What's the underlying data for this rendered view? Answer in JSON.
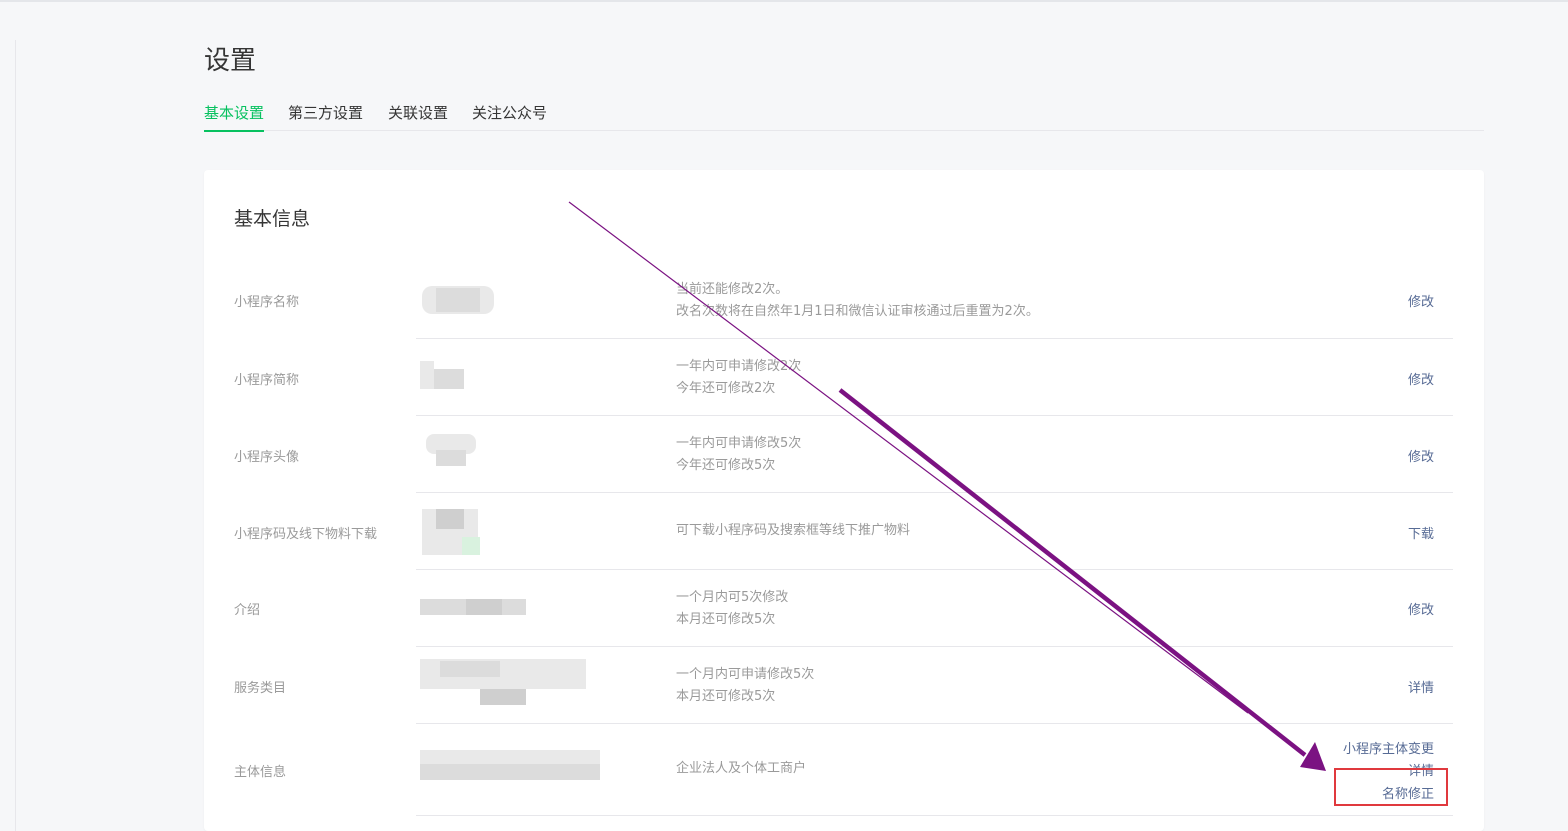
{
  "page": {
    "title": "设置"
  },
  "tabs": [
    {
      "label": "基本设置",
      "active": true
    },
    {
      "label": "第三方设置",
      "active": false
    },
    {
      "label": "关联设置",
      "active": false
    },
    {
      "label": "关注公众号",
      "active": false
    }
  ],
  "card": {
    "title": "基本信息"
  },
  "rows": [
    {
      "label": "小程序名称",
      "desc1": "当前还能修改2次。",
      "desc2": "改名次数将在自然年1月1日和微信认证审核通过后重置为2次。",
      "action": "修改"
    },
    {
      "label": "小程序简称",
      "desc1": "一年内可申请修改2次",
      "desc2": "今年还可修改2次",
      "action": "修改"
    },
    {
      "label": "小程序头像",
      "desc1": "一年内可申请修改5次",
      "desc2": "今年还可修改5次",
      "action": "修改"
    },
    {
      "label": "小程序码及线下物料下载",
      "desc1": "可下载小程序码及搜索框等线下推广物料",
      "desc2": "",
      "action": "下载"
    },
    {
      "label": "介绍",
      "desc1": "一个月内可5次修改",
      "desc2": "本月还可修改5次",
      "action": "修改"
    },
    {
      "label": "服务类目",
      "desc1": "一个月内可申请修改5次",
      "desc2": "本月还可修改5次",
      "action": "详情"
    },
    {
      "label": "主体信息",
      "desc1": "企业法人及个体工商户",
      "desc2": "",
      "actions": [
        "小程序主体变更",
        "详情",
        "名称修正"
      ]
    }
  ],
  "colors": {
    "accent": "#07c160",
    "link": "#576b95",
    "highlight": "#e0393e",
    "arrow": "#7b1282"
  }
}
